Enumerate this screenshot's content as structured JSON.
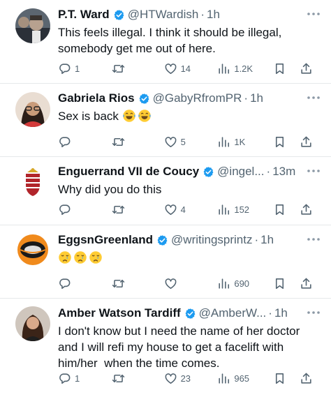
{
  "tweets": [
    {
      "name": "P.T. Ward",
      "handle": "@HTWardish",
      "time": "1h",
      "text_lines": [
        "This feels illegal. I think it should be illegal,",
        "somebody get me out of here."
      ],
      "reply_count": "1",
      "retweet_count": "",
      "like_count": "14",
      "view_count": "1.2K"
    },
    {
      "name": "Gabriela Rios",
      "handle": "@GabyRfromPR",
      "time": "1h",
      "text": "Sex is back",
      "emoji_icons": [
        "tears-of-joy",
        "tears-of-joy"
      ],
      "reply_count": "",
      "retweet_count": "",
      "like_count": "5",
      "view_count": "1K"
    },
    {
      "name": "Enguerrand VII de Coucy",
      "handle": "@ingel...",
      "time": "13m",
      "text": "Why did you do this",
      "reply_count": "",
      "retweet_count": "",
      "like_count": "4",
      "view_count": "152"
    },
    {
      "name": "EggsnGreenland",
      "handle": "@writingsprintz",
      "time": "1h",
      "emoji_icons": [
        "crying-face",
        "crying-face",
        "crying-face"
      ],
      "reply_count": "",
      "retweet_count": "",
      "like_count": "",
      "view_count": "690"
    },
    {
      "name": "Amber Watson Tardiff",
      "handle": "@AmberW...",
      "time": "1h",
      "text_lines": [
        "I don't know but I need the name of her doctor",
        "and I will refi my house to get a facelift with",
        "him/her  when the time comes."
      ],
      "reply_count": "1",
      "retweet_count": "",
      "like_count": "23",
      "view_count": "965"
    }
  ],
  "colors": {
    "verified": "#1d9bf0",
    "meta_gray": "#536471",
    "text": "#0f1419",
    "divider": "#e6e8ea"
  },
  "icons": [
    "reply-icon",
    "retweet-icon",
    "like-icon",
    "views-icon",
    "bookmark-icon",
    "share-icon",
    "more-icon",
    "verified-badge-icon"
  ]
}
